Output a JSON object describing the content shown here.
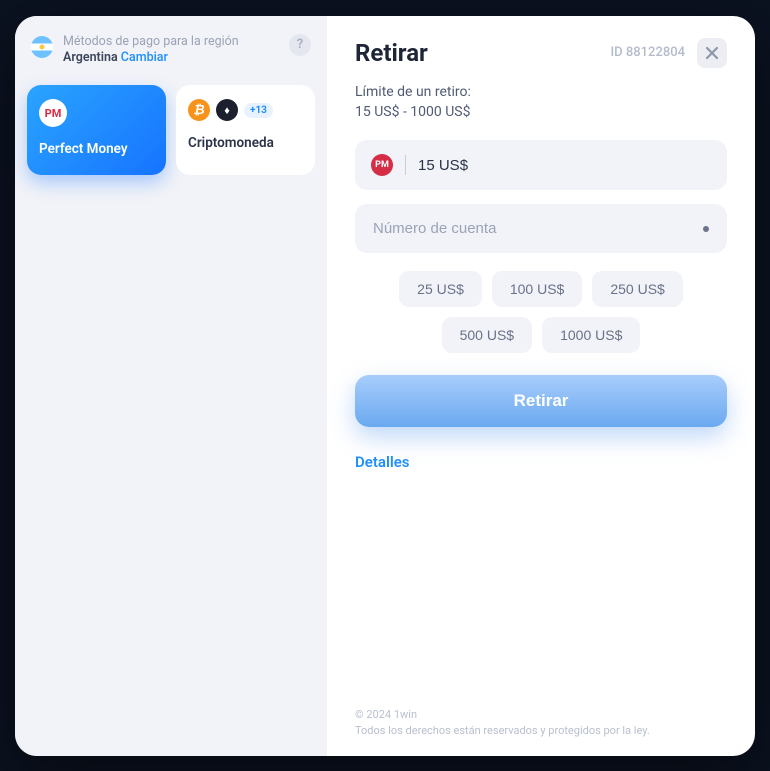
{
  "region": {
    "label": "Métodos de pago para la región",
    "country": "Argentina",
    "change": "Cambiar"
  },
  "methods": [
    {
      "name": "Perfect Money",
      "selected": true
    },
    {
      "name": "Criptomoneda",
      "selected": false,
      "extra_badge": "+13"
    }
  ],
  "header": {
    "title": "Retirar",
    "id_prefix": "ID",
    "id_value": "88122804"
  },
  "limits": {
    "label": "Límite de un retiro:",
    "range": "15 US$ - 1000 US$"
  },
  "amount_field": {
    "value": "15 US$"
  },
  "account_field": {
    "placeholder": "Número de cuenta"
  },
  "quick_amounts": [
    "25 US$",
    "100 US$",
    "250 US$",
    "500 US$",
    "1000 US$"
  ],
  "submit_label": "Retirar",
  "details_label": "Detalles",
  "footer": {
    "copyright": "© 2024 1win",
    "legal": "Todos los derechos están reservados y protegidos por la ley."
  }
}
